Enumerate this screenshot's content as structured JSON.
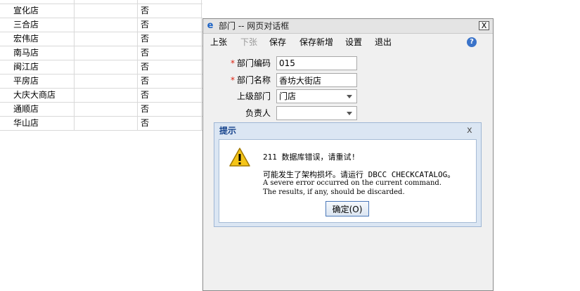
{
  "background_table": {
    "rows": [
      {
        "name": "宣化店",
        "flag": "否"
      },
      {
        "name": "三合店",
        "flag": "否"
      },
      {
        "name": "宏伟店",
        "flag": "否"
      },
      {
        "name": "南马店",
        "flag": "否"
      },
      {
        "name": "闽江店",
        "flag": "否"
      },
      {
        "name": "平房店",
        "flag": "否"
      },
      {
        "name": "大庆大商店",
        "flag": "否"
      },
      {
        "name": "通顺店",
        "flag": "否"
      },
      {
        "name": "华山店",
        "flag": "否"
      }
    ]
  },
  "dialog": {
    "title": "部门 -- 网页对话框",
    "close_label": "X",
    "menu": [
      {
        "label": "上张",
        "enabled": true
      },
      {
        "label": "下张",
        "enabled": false
      },
      {
        "label": "保存",
        "enabled": true
      },
      {
        "label": "保存新增",
        "enabled": true
      },
      {
        "label": "设置",
        "enabled": true
      },
      {
        "label": "退出",
        "enabled": true
      }
    ],
    "help_icon": "?",
    "form": {
      "code_label": "部门编码",
      "code_value": "015",
      "name_label": "部门名称",
      "name_value": "香坊大街店",
      "parent_label": "上级部门",
      "parent_value": "门店",
      "owner_label": "负责人",
      "owner_value": "",
      "required_mark": "*"
    }
  },
  "message_box": {
    "title": "提示",
    "close_label": "x",
    "line1": "211 数据库错误，请重试!",
    "line2": "可能发生了架构损坏。请运行 DBCC CHECKCATALOG。",
    "line3": "A severe error occurred on the current command.",
    "line4": "The results, if any, should be discarded.",
    "ok_label": "确定(O)",
    "icon": "warning-icon"
  },
  "colors": {
    "required": "#dd1111",
    "msgbox_title": "#15428b",
    "msgbox_frame": "#dbe6f3"
  }
}
